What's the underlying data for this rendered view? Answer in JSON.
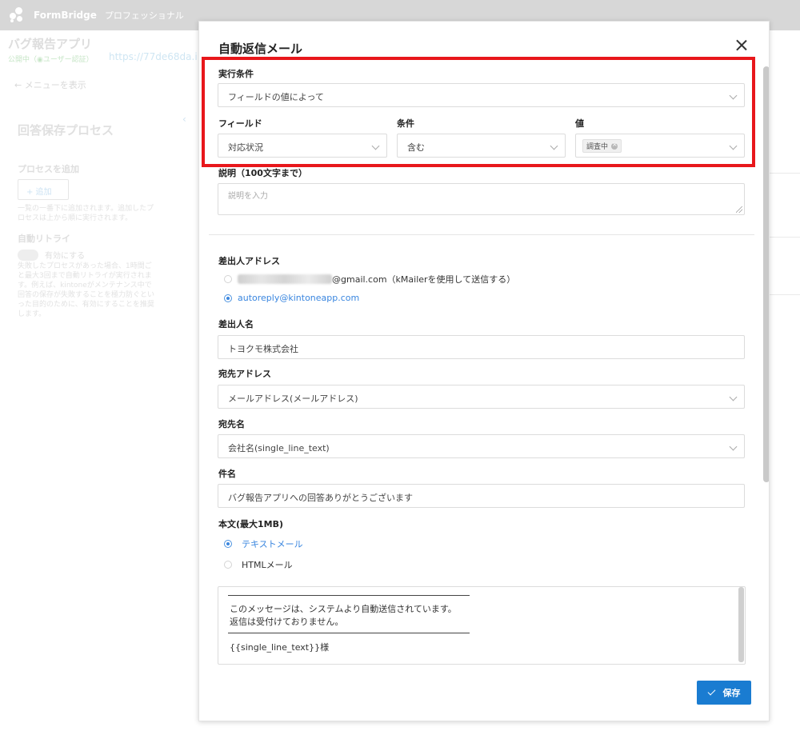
{
  "topbar": {
    "brand": "FormBridge",
    "edition": "プロフェッショナル",
    "logo_icon": "formbridge-logo-icon"
  },
  "background": {
    "app_title": "バグ報告アプリ",
    "status": "公開中（◉ユーザー認証）",
    "url": "https://77de68da.i",
    "menu_link": "← メニューを表示",
    "section_title": "回答保存プロセス",
    "add_process_label": "プロセスを追加",
    "add_button": "+ 追加",
    "add_help_1": "一覧の一番下に追加されます。追加したプ",
    "add_help_2": "ロセスは上から順に実行されます。",
    "retry_label": "自動リトライ",
    "retry_toggle_label": "有効にする",
    "retry_help_1": "失敗したプロセスがあった場合、1時間ご",
    "retry_help_2": "と最大3回まで自動リトライが実行されま",
    "retry_help_3": "す。例えば、kintoneがメンテナンス中で",
    "retry_help_4": "回答の保存が失敗することを極力防ぐとい",
    "retry_help_5": "った目的のために、有効にすることを推奨",
    "retry_help_6": "します。"
  },
  "modal": {
    "title": "自動返信メール",
    "condition": {
      "label": "実行条件",
      "value": "フィールドの値によって",
      "field_label": "フィールド",
      "field_value": "対応状況",
      "operator_label": "条件",
      "operator_value": "含む",
      "value_label": "値",
      "value_tag": "調査中"
    },
    "description": {
      "label": "説明（100文字まで）",
      "placeholder": "説明を入力"
    },
    "sender_address": {
      "label": "差出人アドレス",
      "option1_suffix": "@gmail.com（kMailerを使用して送信する）",
      "option2": "autoreply@kintoneapp.com",
      "selected": "autoreply@kintoneapp.com"
    },
    "sender_name": {
      "label": "差出人名",
      "value": "トヨクモ株式会社"
    },
    "recipient_address": {
      "label": "宛先アドレス",
      "value": "メールアドレス(メールアドレス)"
    },
    "recipient_name": {
      "label": "宛先名",
      "value": "会社名(single_line_text)"
    },
    "subject": {
      "label": "件名",
      "value": "バグ報告アプリへの回答ありがとうございます"
    },
    "body": {
      "label": "本文(最大1MB)",
      "format_text": "テキストメール",
      "format_html": "HTMLメール",
      "selected_format": "テキストメール",
      "line1": "このメッセージは、システムより自動送信されています。",
      "line2": "返信は受付けておりません。",
      "line3": "{{single_line_text}}様"
    },
    "save_button": "保存"
  },
  "colors": {
    "accent": "#1a7cd1",
    "highlight": "#e8171b",
    "link": "#3a86df"
  }
}
